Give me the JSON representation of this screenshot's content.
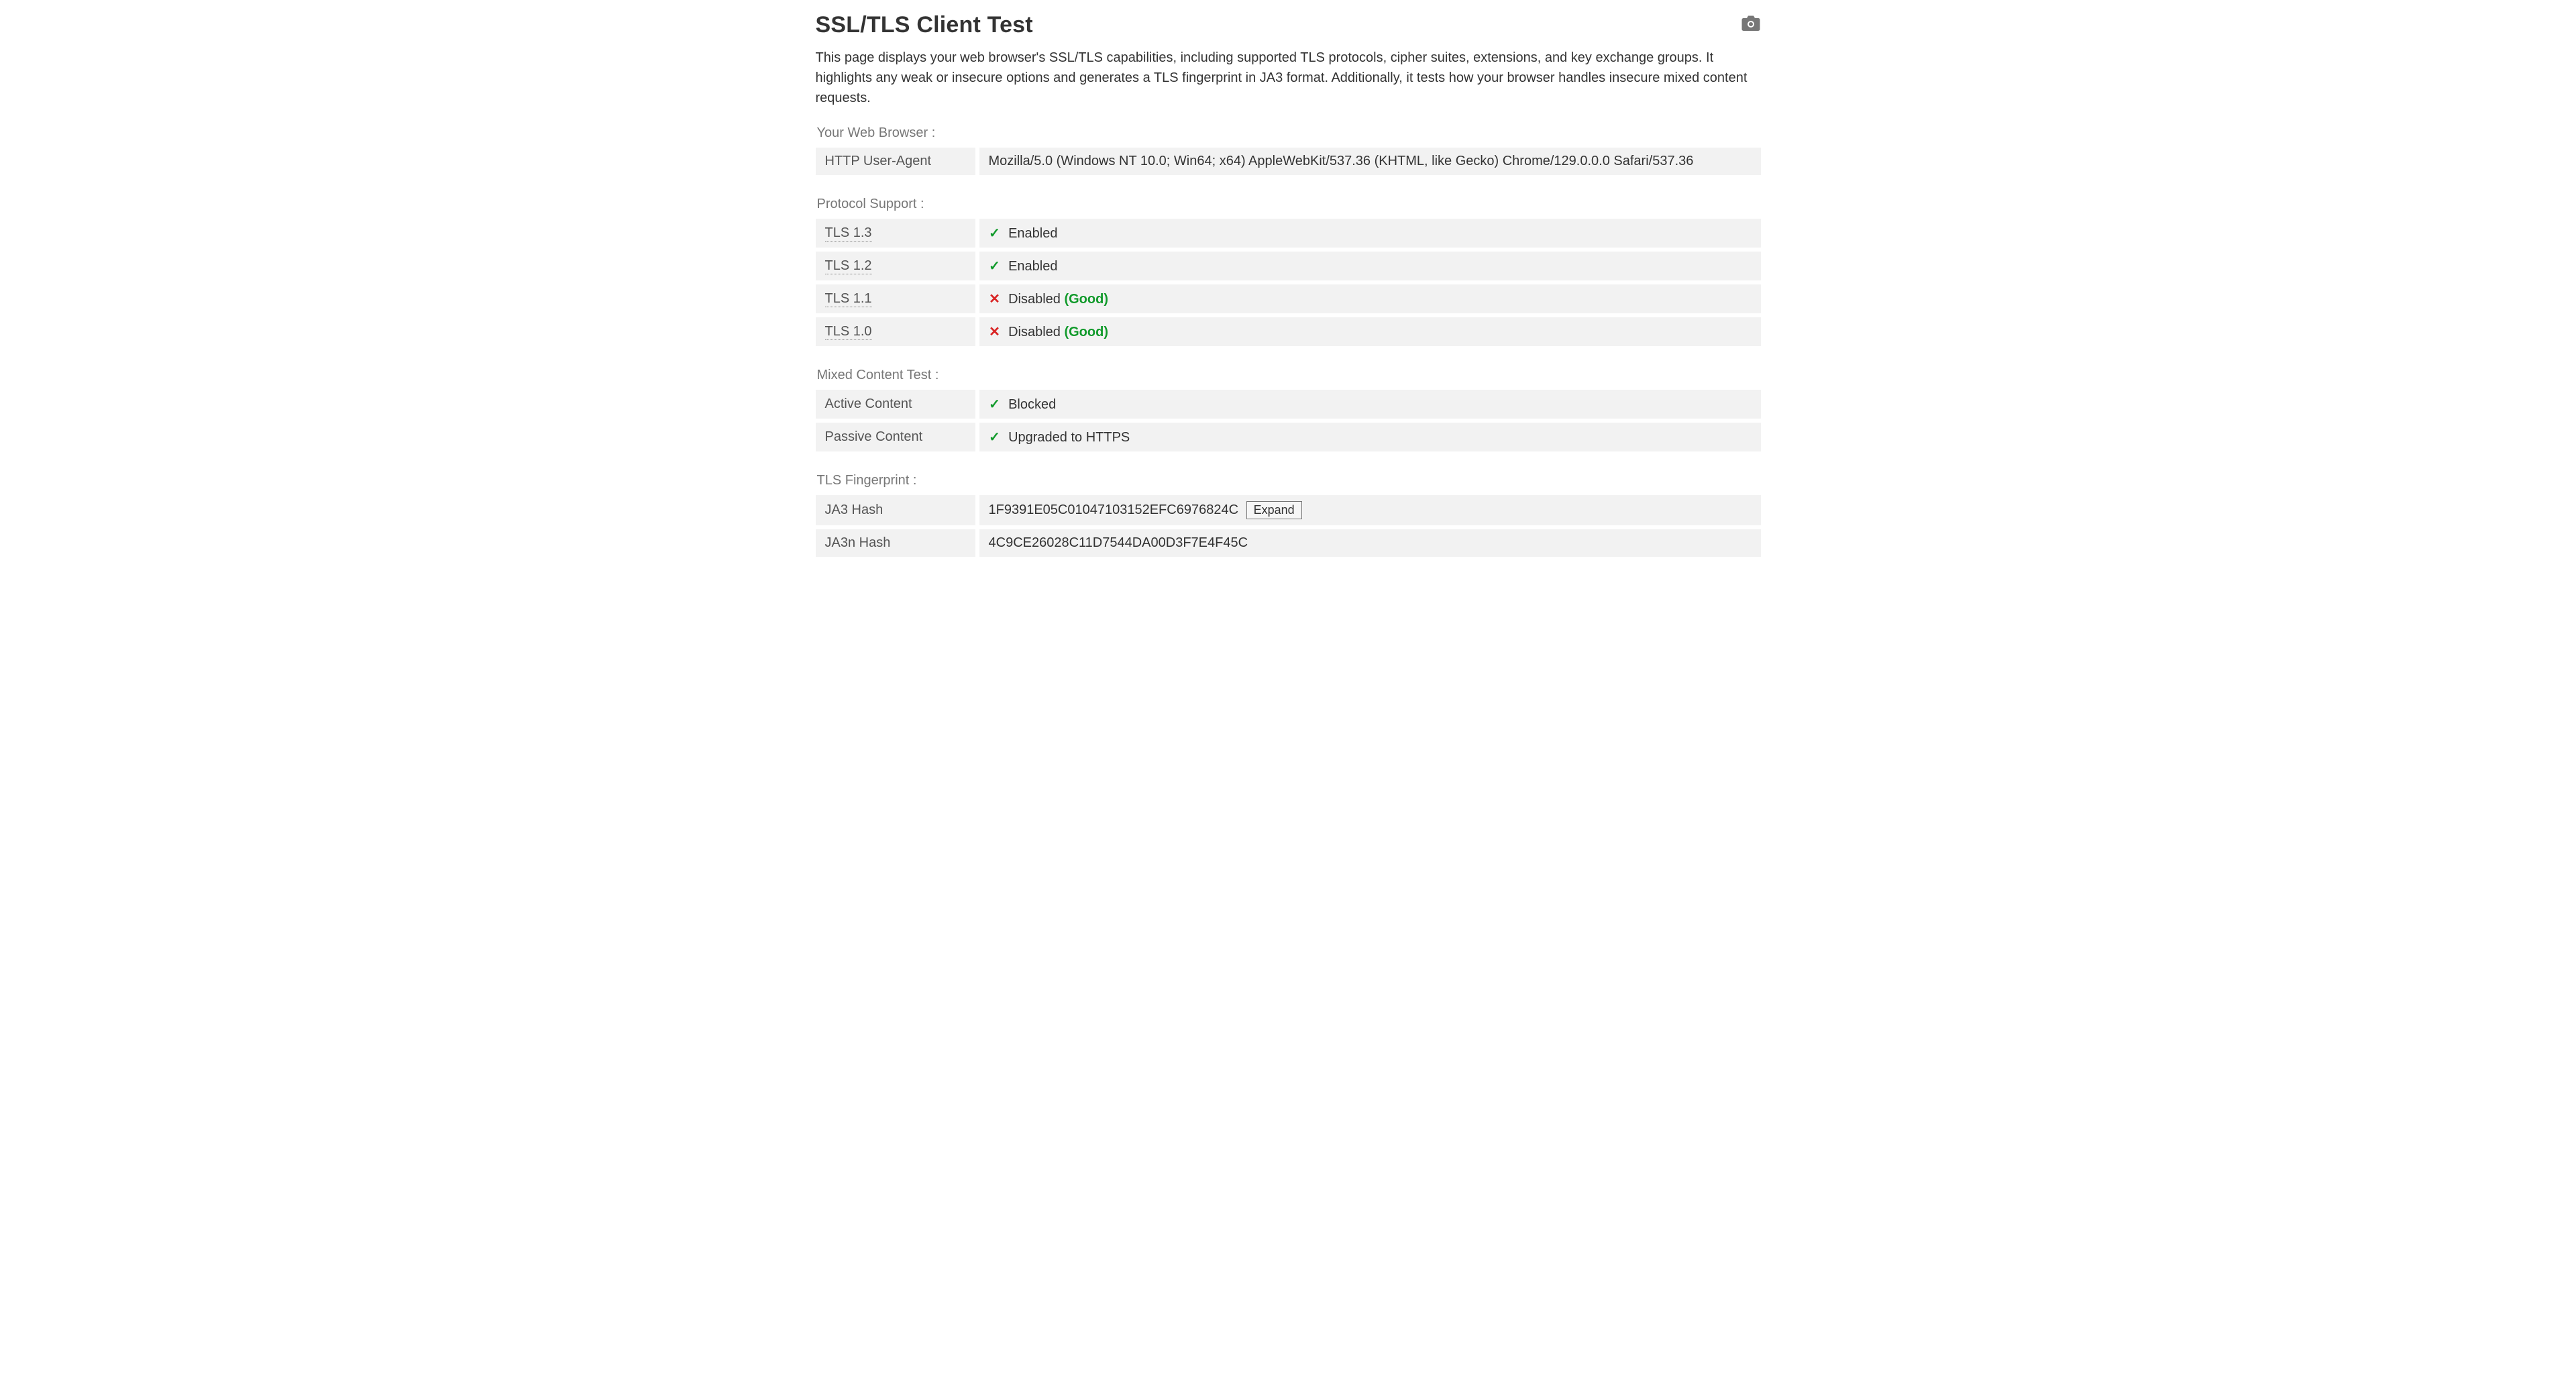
{
  "page": {
    "title": "SSL/TLS Client Test",
    "intro": "This page displays your web browser's SSL/TLS capabilities, including supported TLS protocols, cipher suites, extensions, and key exchange groups. It highlights any weak or insecure options and generates a TLS fingerprint in JA3 format. Additionally, it tests how your browser handles insecure mixed content requests."
  },
  "browser_section": {
    "title": "Your Web Browser :",
    "user_agent_label": "HTTP User-Agent",
    "user_agent_value": "Mozilla/5.0 (Windows NT 10.0; Win64; x64) AppleWebKit/537.36 (KHTML, like Gecko) Chrome/129.0.0.0 Safari/537.36"
  },
  "protocol_section": {
    "title": "Protocol Support :",
    "rows": {
      "tls13": {
        "label": "TLS 1.3",
        "status": "Enabled"
      },
      "tls12": {
        "label": "TLS 1.2",
        "status": "Enabled"
      },
      "tls11": {
        "label": "TLS 1.1",
        "status": "Disabled",
        "note": "(Good)"
      },
      "tls10": {
        "label": "TLS 1.0",
        "status": "Disabled",
        "note": "(Good)"
      }
    }
  },
  "mixed_content_section": {
    "title": "Mixed Content Test :",
    "rows": {
      "active": {
        "label": "Active Content",
        "status": "Blocked"
      },
      "passive": {
        "label": "Passive Content",
        "status": "Upgraded to HTTPS"
      }
    }
  },
  "fingerprint_section": {
    "title": "TLS Fingerprint :",
    "rows": {
      "ja3": {
        "label": "JA3 Hash",
        "value": "1F9391E05C01047103152EFC6976824C",
        "expand_label": "Expand"
      },
      "ja3n": {
        "label": "JA3n Hash",
        "value": "4C9CE26028C11D7544DA00D3F7E4F45C"
      }
    }
  },
  "colors": {
    "good_green": "#119a2b",
    "bad_red": "#d92424",
    "row_bg": "#f2f2f2",
    "muted": "#777777"
  }
}
